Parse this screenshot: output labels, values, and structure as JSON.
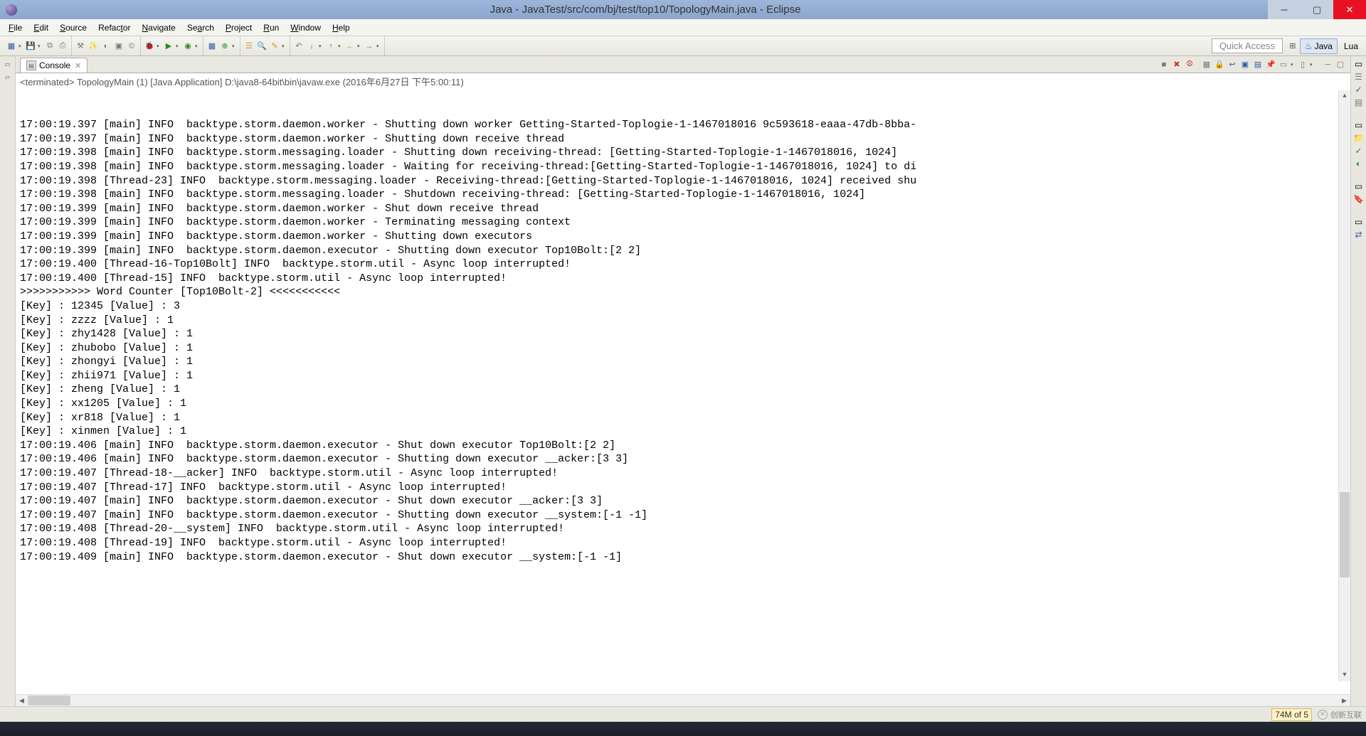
{
  "window": {
    "title": "Java - JavaTest/src/com/bj/test/top10/TopologyMain.java - Eclipse"
  },
  "menu": {
    "file": "File",
    "edit": "Edit",
    "source": "Source",
    "refactor": "Refactor",
    "navigate": "Navigate",
    "search": "Search",
    "project": "Project",
    "run": "Run",
    "window": "Window",
    "help": "Help"
  },
  "toolbar": {
    "quick_access": "Quick Access"
  },
  "perspectives": {
    "java": "Java",
    "lua": "Lua"
  },
  "console": {
    "tab_label": "Console",
    "header": "<terminated> TopologyMain (1) [Java Application] D:\\java8-64bit\\bin\\javaw.exe (2016年6月27日 下午5:00:11)",
    "lines": [
      "17:00:19.397 [main] INFO  backtype.storm.daemon.worker - Shutting down worker Getting-Started-Toplogie-1-1467018016 9c593618-eaaa-47db-8bba-",
      "17:00:19.397 [main] INFO  backtype.storm.daemon.worker - Shutting down receive thread",
      "17:00:19.398 [main] INFO  backtype.storm.messaging.loader - Shutting down receiving-thread: [Getting-Started-Toplogie-1-1467018016, 1024]",
      "17:00:19.398 [main] INFO  backtype.storm.messaging.loader - Waiting for receiving-thread:[Getting-Started-Toplogie-1-1467018016, 1024] to di",
      "17:00:19.398 [Thread-23] INFO  backtype.storm.messaging.loader - Receiving-thread:[Getting-Started-Toplogie-1-1467018016, 1024] received shu",
      "17:00:19.398 [main] INFO  backtype.storm.messaging.loader - Shutdown receiving-thread: [Getting-Started-Toplogie-1-1467018016, 1024]",
      "17:00:19.399 [main] INFO  backtype.storm.daemon.worker - Shut down receive thread",
      "17:00:19.399 [main] INFO  backtype.storm.daemon.worker - Terminating messaging context",
      "17:00:19.399 [main] INFO  backtype.storm.daemon.worker - Shutting down executors",
      "17:00:19.399 [main] INFO  backtype.storm.daemon.executor - Shutting down executor Top10Bolt:[2 2]",
      "17:00:19.400 [Thread-16-Top10Bolt] INFO  backtype.storm.util - Async loop interrupted!",
      "17:00:19.400 [Thread-15] INFO  backtype.storm.util - Async loop interrupted!",
      ">>>>>>>>>>> Word Counter [Top10Bolt-2] <<<<<<<<<<<",
      "[Key] : 12345 [Value] : 3",
      "[Key] : zzzz [Value] : 1",
      "[Key] : zhy1428 [Value] : 1",
      "[Key] : zhubobo [Value] : 1",
      "[Key] : zhongyi [Value] : 1",
      "[Key] : zhii971 [Value] : 1",
      "[Key] : zheng [Value] : 1",
      "[Key] : xx1205 [Value] : 1",
      "[Key] : xr818 [Value] : 1",
      "[Key] : xinmen [Value] : 1",
      "17:00:19.406 [main] INFO  backtype.storm.daemon.executor - Shut down executor Top10Bolt:[2 2]",
      "17:00:19.406 [main] INFO  backtype.storm.daemon.executor - Shutting down executor __acker:[3 3]",
      "17:00:19.407 [Thread-18-__acker] INFO  backtype.storm.util - Async loop interrupted!",
      "17:00:19.407 [Thread-17] INFO  backtype.storm.util - Async loop interrupted!",
      "17:00:19.407 [main] INFO  backtype.storm.daemon.executor - Shut down executor __acker:[3 3]",
      "17:00:19.407 [main] INFO  backtype.storm.daemon.executor - Shutting down executor __system:[-1 -1]",
      "17:00:19.408 [Thread-20-__system] INFO  backtype.storm.util - Async loop interrupted!",
      "17:00:19.408 [Thread-19] INFO  backtype.storm.util - Async loop interrupted!",
      "17:00:19.409 [main] INFO  backtype.storm.daemon.executor - Shut down executor __system:[-1 -1]"
    ]
  },
  "status": {
    "memory": "74M of 5",
    "brand": "创新互联"
  }
}
